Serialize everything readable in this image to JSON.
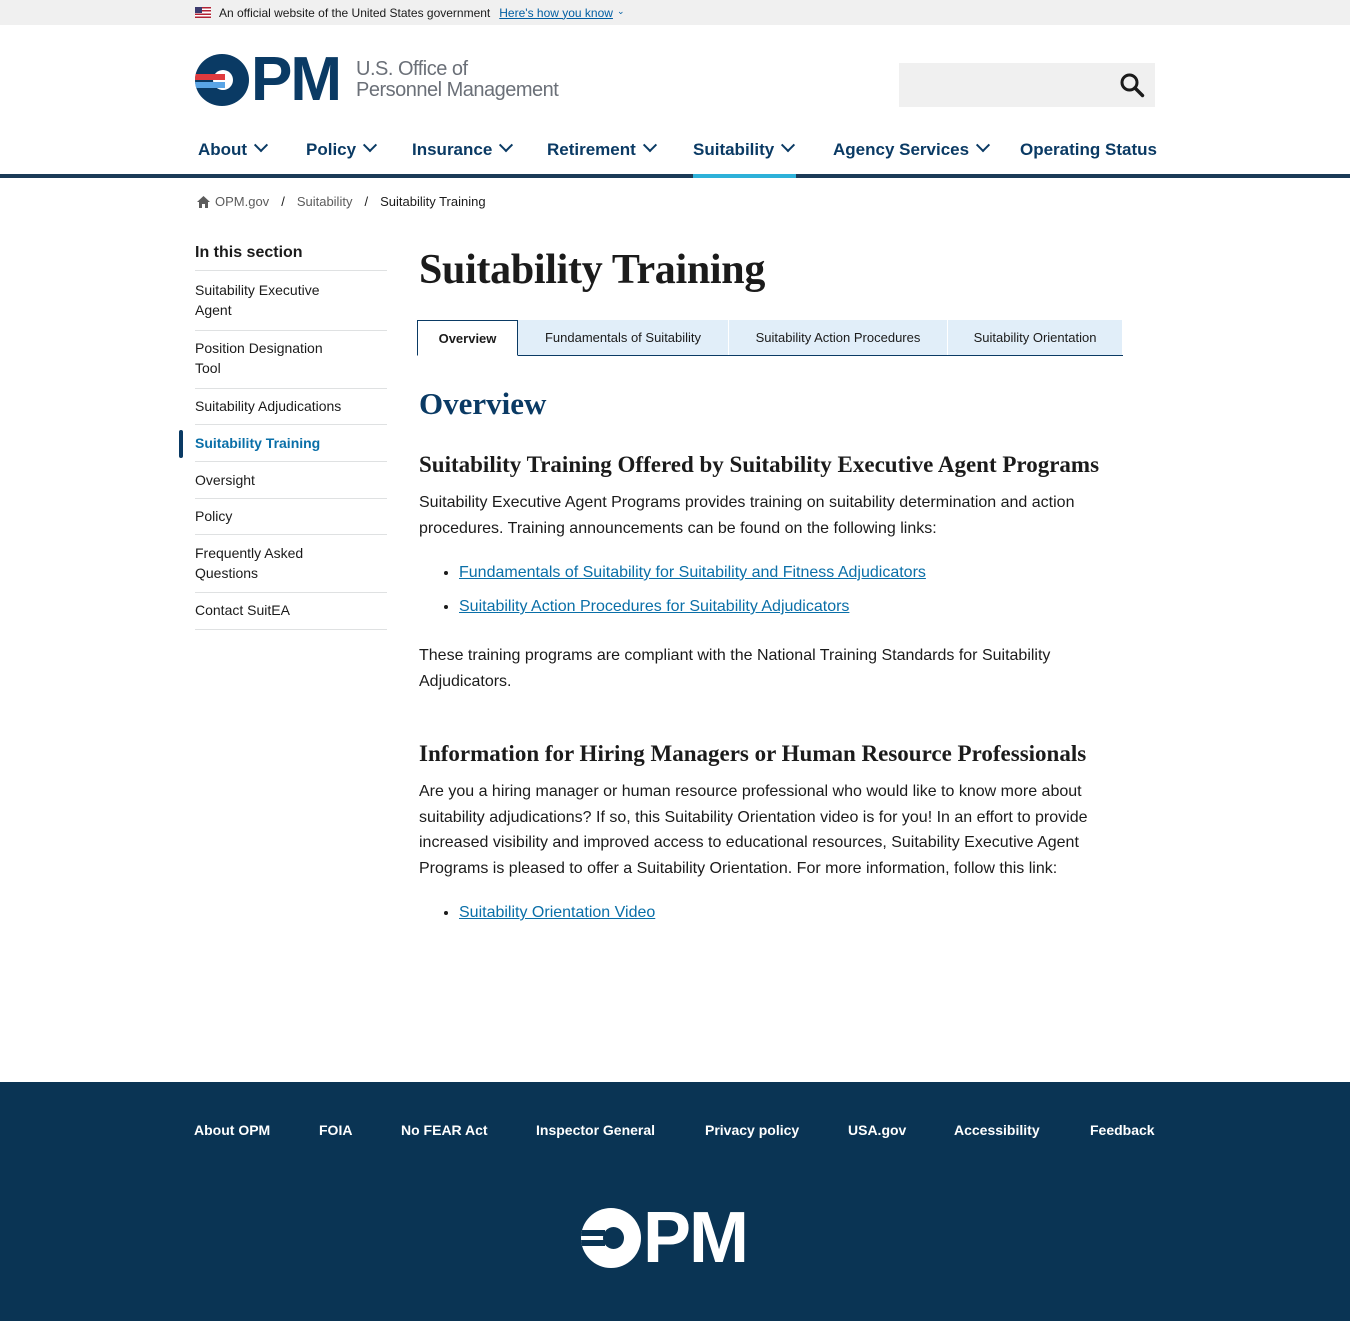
{
  "gov_banner": {
    "text": "An official website of the United States government",
    "link": "Here's how you know"
  },
  "logo": {
    "letters": "PM",
    "line1": "U.S. Office of",
    "line2": "Personnel Management"
  },
  "search": {
    "placeholder": ""
  },
  "nav": [
    {
      "label": "About",
      "dropdown": true
    },
    {
      "label": "Policy",
      "dropdown": true
    },
    {
      "label": "Insurance",
      "dropdown": true
    },
    {
      "label": "Retirement",
      "dropdown": true
    },
    {
      "label": "Suitability",
      "dropdown": true,
      "active": true
    },
    {
      "label": "Agency Services",
      "dropdown": true
    },
    {
      "label": "Operating Status",
      "dropdown": false
    }
  ],
  "breadcrumb": {
    "home": "OPM.gov",
    "parent": "Suitability",
    "current": "Suitability Training"
  },
  "sidebar": {
    "heading": "In this section",
    "items": [
      "Suitability Executive Agent",
      "Position Designation Tool",
      "Suitability Adjudications",
      "Suitability Training",
      "Oversight",
      "Policy",
      "Frequently Asked Questions",
      "Contact SuitEA"
    ],
    "active_index": 3
  },
  "main": {
    "title": "Suitability Training",
    "tabs": [
      "Overview",
      "Fundamentals of Suitability",
      "Suitability Action Procedures",
      "Suitability Orientation"
    ],
    "section_title": "Overview",
    "h3_1": "Suitability Training Offered by Suitability Executive Agent Programs",
    "p1": "Suitability Executive Agent Programs provides training on suitability determination and action procedures. Training announcements can be found on the following links:",
    "links1": [
      "Fundamentals of Suitability for Suitability and Fitness Adjudicators",
      "Suitability Action Procedures for Suitability Adjudicators"
    ],
    "p2": "These training programs are compliant with the National Training Standards for Suitability Adjudicators.",
    "h3_2": "Information for Hiring Managers or Human Resource Professionals",
    "p3": "Are you a hiring manager or human resource professional who would like to know more about suitability adjudications? If so, this Suitability Orientation video is for you! In an effort to provide increased visibility and improved access to educational resources, Suitability Executive Agent Programs is pleased to offer a Suitability Orientation. For more information, follow this link:",
    "links2": [
      "Suitability Orientation Video"
    ]
  },
  "footer": {
    "links": [
      "About OPM",
      "FOIA",
      "No FEAR Act",
      "Inspector General",
      "Privacy policy",
      "USA.gov",
      "Accessibility",
      "Feedback"
    ],
    "logo_letters": "PM"
  },
  "colors": {
    "navy": "#0a3a64",
    "accent": "#2db1d9",
    "link": "#0a6fa8",
    "footer_bg": "#0a3454",
    "tab_bg": "#e1eef9"
  }
}
